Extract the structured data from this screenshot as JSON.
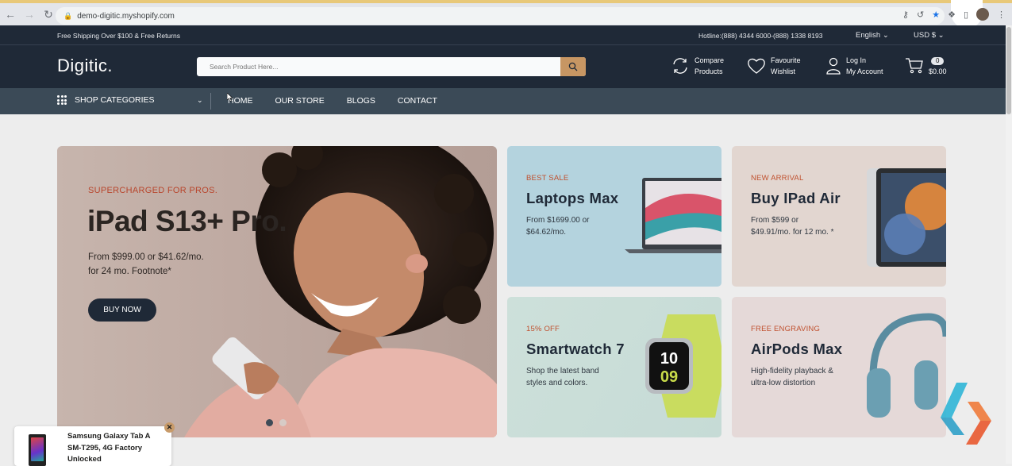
{
  "browser": {
    "url": "demo-digitic.myshopify.com",
    "icons": [
      "back-icon",
      "forward-icon",
      "reload-icon",
      "lock-icon",
      "key-icon",
      "share-icon",
      "star-icon",
      "extensions-icon",
      "profile-avatar",
      "menu-dots-icon"
    ]
  },
  "topbar": {
    "shipping": "Free Shipping Over $100 & Free Returns",
    "hotline": "Hotline:(888) 4344 6000-(888) 1338 8193",
    "language": "English",
    "currency": "USD $"
  },
  "header": {
    "logo": "Digitic.",
    "search_placeholder": "Search Product Here...",
    "compare_line1": "Compare",
    "compare_line2": "Products",
    "wishlist_line1": "Favourite",
    "wishlist_line2": "Wishlist",
    "account_line1": "Log In",
    "account_line2": "My Account",
    "cart_count": "0",
    "cart_total": "$0.00"
  },
  "nav": {
    "categories": "SHOP CATEGORIES",
    "items": [
      "HOME",
      "OUR STORE",
      "BLOGS",
      "CONTACT"
    ]
  },
  "hero": {
    "eyebrow": "SUPERCHARGED FOR PROS.",
    "title": "iPad S13+ Pro.",
    "desc_line1": "From $999.00 or $41.62/mo.",
    "desc_line2": "for 24 mo. Footnote*",
    "button": "BUY NOW"
  },
  "cards": [
    {
      "tag": "BEST SALE",
      "title": "Laptops Max",
      "sub_line1": "From $1699.00 or",
      "sub_line2": "$64.62/mo.",
      "tag_color": "#c0502e"
    },
    {
      "tag": "NEW ARRIVAL",
      "title": "Buy IPad Air",
      "sub_line1": "From $599 or",
      "sub_line2": "$49.91/mo. for 12 mo. *",
      "tag_color": "#c0502e"
    },
    {
      "tag": "15% OFF",
      "title": "Smartwatch 7",
      "sub_line1": "Shop the latest band",
      "sub_line2": "styles and colors.",
      "tag_color": "#c0502e"
    },
    {
      "tag": "FREE ENGRAVING",
      "title": "AirPods Max",
      "sub_line1": "High-fidelity playback &",
      "sub_line2": "ultra-low distortion",
      "tag_color": "#c0502e"
    }
  ],
  "watch_face": {
    "hour": "10",
    "minute": "09"
  },
  "toast": {
    "line1": "Samsung Galaxy Tab A",
    "line2": "SM-T295, 4G Factory",
    "line3": "Unlocked"
  },
  "colors": {
    "header_bg": "#1f2937",
    "nav_bg": "#3b4a57",
    "accent": "#c79663",
    "tag": "#c0502e"
  }
}
